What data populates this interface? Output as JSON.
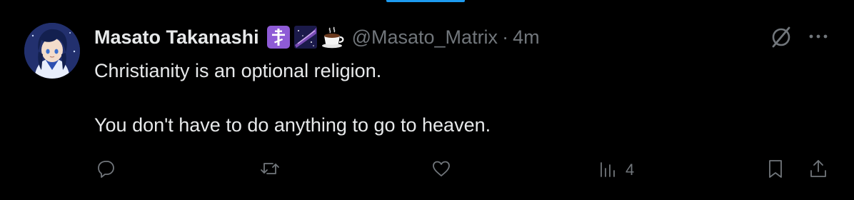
{
  "tweet": {
    "author_name": "Masato Takanashi",
    "handle": "@Masato_Matrix",
    "separator": "·",
    "timestamp": "4m",
    "body": [
      "Christianity is an optional religion.",
      "You don't have to do anything to go to heaven."
    ],
    "emoji_icons": [
      "orthodox-cross-icon",
      "milky-way-icon",
      "hot-beverage-icon"
    ]
  },
  "actions": {
    "reply_count": "",
    "repost_count": "",
    "like_count": "",
    "views_count": "4"
  },
  "colors": {
    "background": "#000000",
    "text": "#e7e9ea",
    "muted": "#71767b",
    "accent": "#1d9bf0"
  }
}
